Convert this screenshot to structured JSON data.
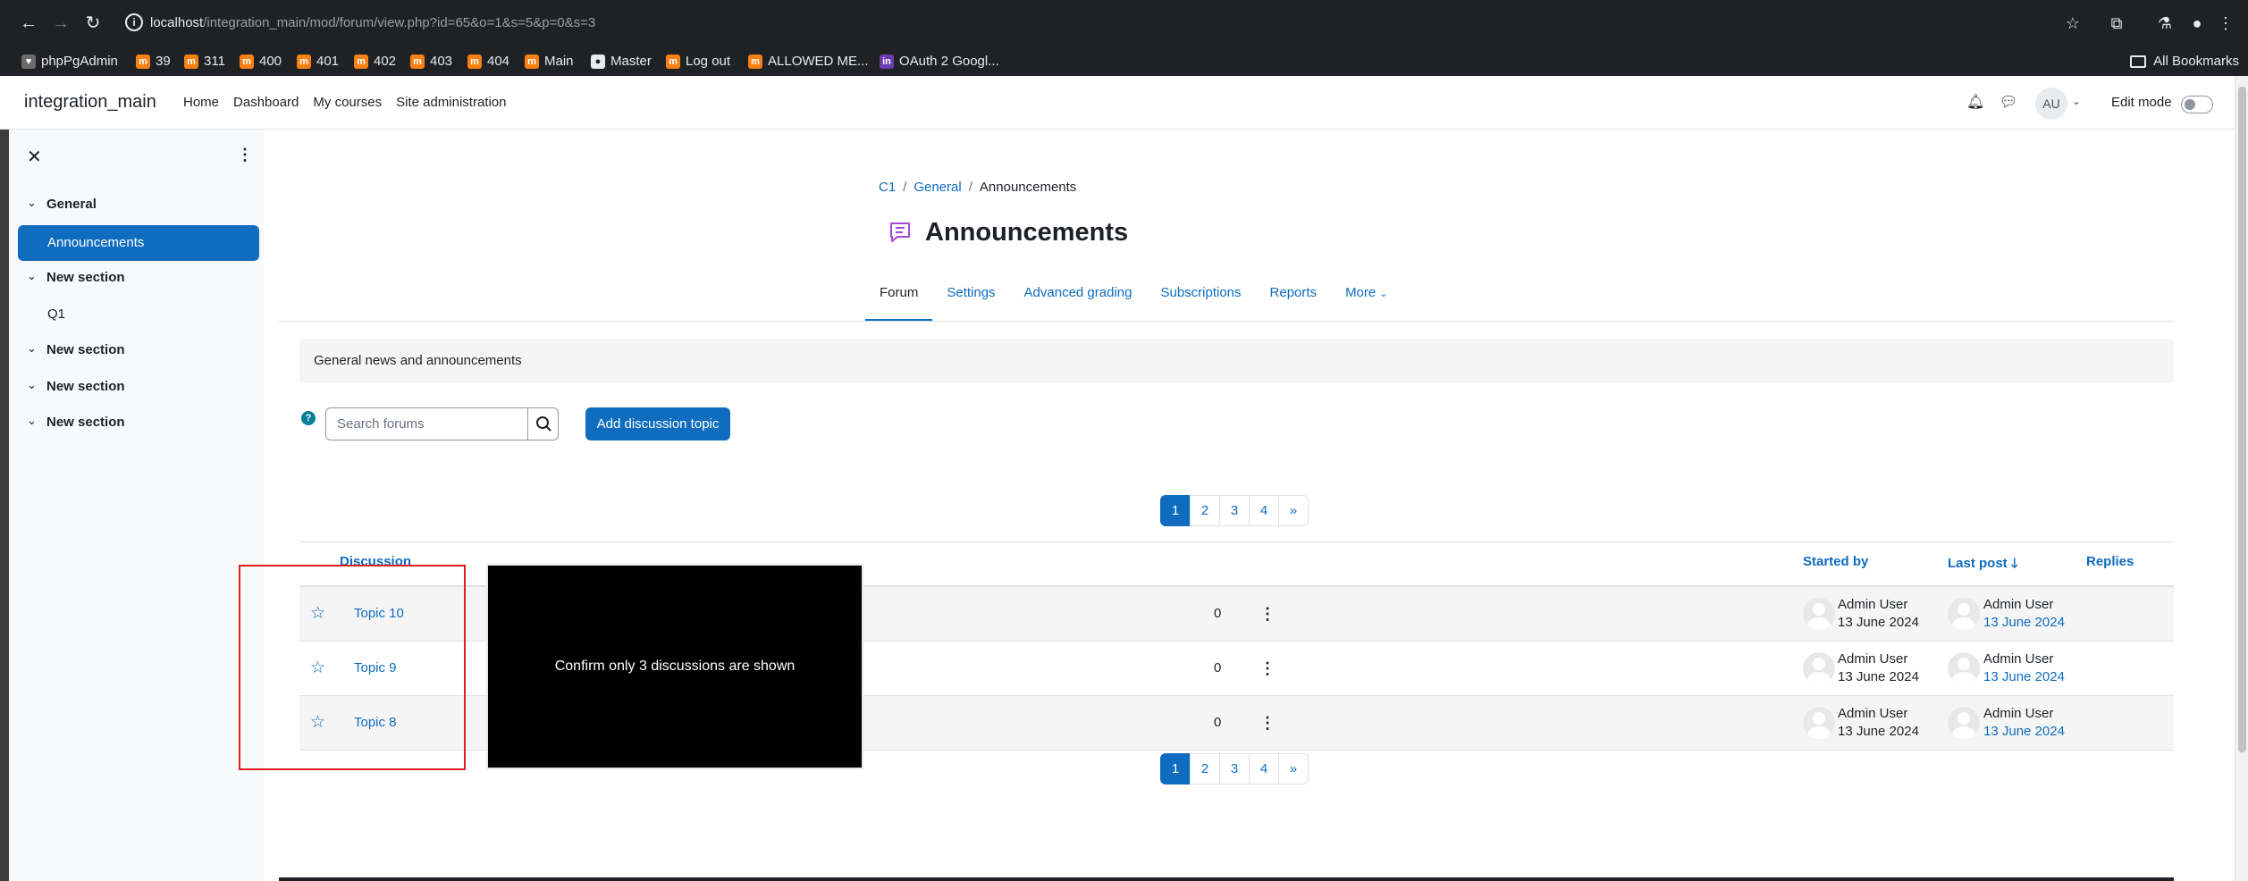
{
  "browser": {
    "url_host": "localhost",
    "url_path": "/integration_main/mod/forum/view.php?id=65&o=1&s=5&p=0&s=3",
    "bookmarks": [
      {
        "label": "phpPgAdmin",
        "icon": "pg"
      },
      {
        "label": "39",
        "icon": "moodle"
      },
      {
        "label": "311",
        "icon": "moodle"
      },
      {
        "label": "400",
        "icon": "moodle"
      },
      {
        "label": "401",
        "icon": "moodle"
      },
      {
        "label": "402",
        "icon": "moodle"
      },
      {
        "label": "403",
        "icon": "moodle"
      },
      {
        "label": "404",
        "icon": "moodle"
      },
      {
        "label": "Main",
        "icon": "moodle"
      },
      {
        "label": "Master",
        "icon": "github"
      },
      {
        "label": "Log out",
        "icon": "moodle"
      },
      {
        "label": "ALLOWED ME...",
        "icon": "m"
      },
      {
        "label": "OAuth 2 Googl...",
        "icon": "in"
      }
    ],
    "all_bookmarks": "All Bookmarks"
  },
  "navbar": {
    "brand": "integration_main",
    "links": [
      "Home",
      "Dashboard",
      "My courses",
      "Site administration"
    ],
    "avatar_initials": "AU",
    "edit_mode_label": "Edit mode"
  },
  "course_index": {
    "sections": [
      {
        "title": "General",
        "items": [
          "Announcements"
        ]
      },
      {
        "title": "New section",
        "items": [
          "Q1"
        ]
      },
      {
        "title": "New section",
        "items": []
      },
      {
        "title": "New section",
        "items": []
      },
      {
        "title": "New section",
        "items": []
      }
    ],
    "active_item": "Announcements"
  },
  "breadcrumb": [
    "C1",
    "General",
    "Announcements"
  ],
  "page_title": "Announcements",
  "tabs": [
    "Forum",
    "Settings",
    "Advanced grading",
    "Subscriptions",
    "Reports",
    "More"
  ],
  "active_tab": "Forum",
  "intro": "General news and announcements",
  "search": {
    "placeholder": "Search forums"
  },
  "add_discussion_label": "Add discussion topic",
  "pagination": {
    "pages": [
      "1",
      "2",
      "3",
      "4",
      "»"
    ],
    "current": "1"
  },
  "table": {
    "headers": {
      "discussion": "Discussion",
      "started_by": "Started by",
      "last_post": "Last post",
      "replies": "Replies"
    },
    "rows": [
      {
        "topic": "Topic 10",
        "started_name": "Admin User",
        "started_date": "13 June 2024",
        "last_name": "Admin User",
        "last_date": "13 June 2024",
        "replies": "0"
      },
      {
        "topic": "Topic 9",
        "started_name": "Admin User",
        "started_date": "13 June 2024",
        "last_name": "Admin User",
        "last_date": "13 June 2024",
        "replies": "0"
      },
      {
        "topic": "Topic 8",
        "started_name": "Admin User",
        "started_date": "13 June 2024",
        "last_name": "Admin User",
        "last_date": "13 June 2024",
        "replies": "0"
      }
    ]
  },
  "annotation": {
    "text": "Confirm only 3 discussions are shown"
  },
  "colors": {
    "primary": "#0f6cbf",
    "highlight_box": "#e0201e",
    "chrome": "#202124"
  }
}
